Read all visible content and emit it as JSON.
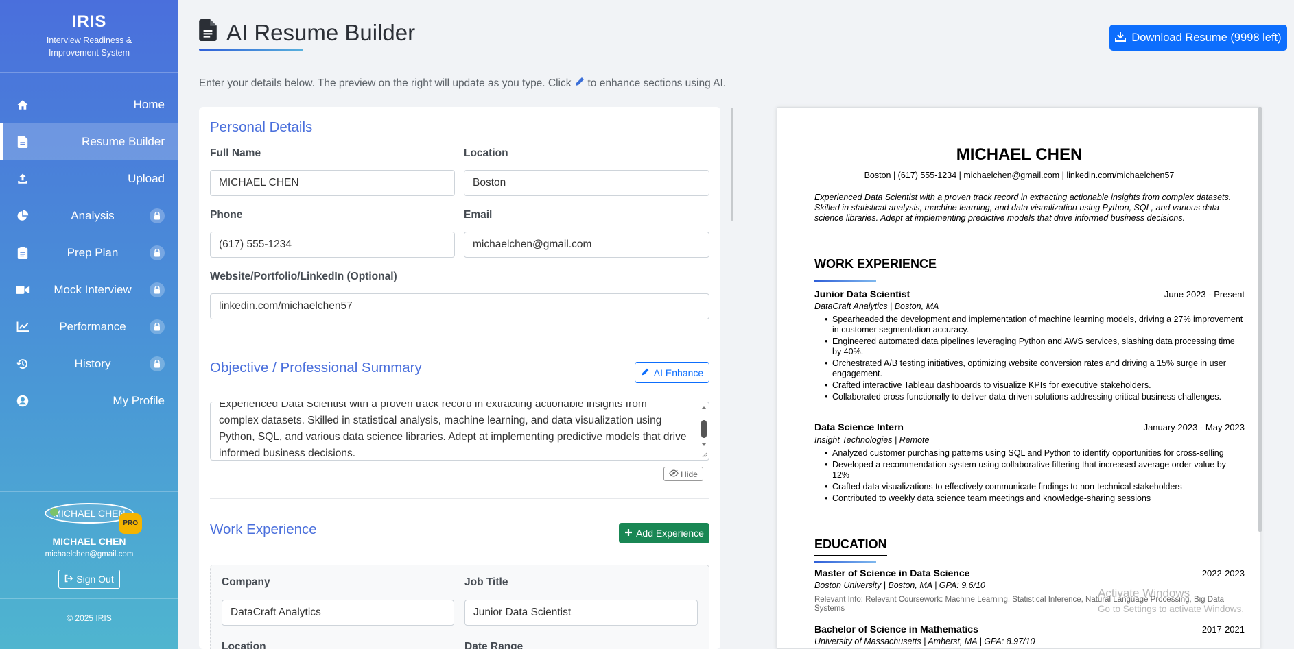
{
  "brand": {
    "title": "IRIS",
    "subtitle": "Interview Readiness & Improvement System"
  },
  "nav": [
    {
      "label": "Home",
      "icon": "home-icon",
      "locked": false,
      "active": false
    },
    {
      "label": "Resume Builder",
      "icon": "file-icon",
      "locked": false,
      "active": true
    },
    {
      "label": "Upload",
      "icon": "upload-icon",
      "locked": false,
      "active": false
    },
    {
      "label": "Analysis",
      "icon": "pie-chart-icon",
      "locked": true,
      "active": false
    },
    {
      "label": "Prep Plan",
      "icon": "clipboard-icon",
      "locked": true,
      "active": false
    },
    {
      "label": "Mock Interview",
      "icon": "video-icon",
      "locked": true,
      "active": false
    },
    {
      "label": "Performance",
      "icon": "line-chart-icon",
      "locked": true,
      "active": false
    },
    {
      "label": "History",
      "icon": "history-icon",
      "locked": true,
      "active": false
    },
    {
      "label": "My Profile",
      "icon": "user-circle-icon",
      "locked": false,
      "active": false
    }
  ],
  "user": {
    "avatar_text": "MICHAEL CHEN",
    "badge": "PRO",
    "name": "MICHAEL CHEN",
    "email": "michaelchen@gmail.com",
    "signout": "Sign Out"
  },
  "copyright": "© 2025 IRIS",
  "header": {
    "title": "AI Resume Builder",
    "download": "Download Resume (9998 left)",
    "intro_before": "Enter your details below. The preview on the right will update as you type. Click",
    "intro_after": "to enhance sections using AI."
  },
  "form": {
    "personal_title": "Personal Details",
    "full_name_label": "Full Name",
    "full_name": "MICHAEL CHEN",
    "location_label": "Location",
    "location": "Boston",
    "phone_label": "Phone",
    "phone": "(617) 555-1234",
    "email_label": "Email",
    "email": "michaelchen@gmail.com",
    "website_label": "Website/Portfolio/LinkedIn (Optional)",
    "website": "linkedin.com/michaelchen57",
    "summary_title": "Objective / Professional Summary",
    "ai_enhance": "AI Enhance",
    "summary_partial": "Experienced Data Scientist with a proven track record in extracting actionable insights from",
    "summary_visible": "complex datasets. Skilled in statistical analysis, machine learning, and data visualization using Python, SQL, and various data science libraries. Adept at implementing predictive models that drive informed business decisions.",
    "hide": "Hide",
    "work_title": "Work Experience",
    "add_experience": "Add Experience",
    "company_label": "Company",
    "company": "DataCraft Analytics",
    "job_title_label": "Job Title",
    "job_title": "Junior Data Scientist",
    "exp_location_label": "Location",
    "date_range_label": "Date Range"
  },
  "resume": {
    "name": "MICHAEL CHEN",
    "contact": "Boston | (617) 555-1234 | michaelchen@gmail.com | linkedin.com/michaelchen57",
    "summary": "Experienced Data Scientist with a proven track record in extracting actionable insights from complex datasets. Skilled in statistical analysis, machine learning, and data visualization using Python, SQL, and various data science libraries. Adept at implementing predictive models that drive informed business decisions.",
    "work_heading": "WORK EXPERIENCE",
    "jobs": [
      {
        "title": "Junior Data Scientist",
        "date": "June 2023 - Present",
        "company": "DataCraft Analytics | Boston, MA",
        "bullets": [
          "Spearheaded the development and implementation of machine learning models, driving a 27% improvement in customer segmentation accuracy.",
          "Engineered automated data pipelines leveraging Python and AWS services, slashing data processing time by 40%.",
          "Orchestrated A/B testing initiatives, optimizing website conversion rates and driving a 15% surge in user engagement.",
          "Crafted interactive Tableau dashboards to visualize KPIs for executive stakeholders.",
          "Collaborated cross-functionally to deliver data-driven solutions addressing critical business challenges."
        ]
      },
      {
        "title": "Data Science Intern",
        "date": "January 2023 - May 2023",
        "company": "Insight Technologies | Remote",
        "bullets": [
          "Analyzed customer purchasing patterns using SQL and Python to identify opportunities for cross-selling",
          "Developed a recommendation system using collaborative filtering that increased average order value by 12%",
          "Crafted data visualizations to effectively communicate findings to non-technical stakeholders",
          "Contributed to weekly data science team meetings and knowledge-sharing sessions"
        ]
      }
    ],
    "education_heading": "EDUCATION",
    "education": [
      {
        "degree": "Master of Science in Data Science",
        "years": "2022-2023",
        "school": "Boston University | Boston, MA | GPA: 9.6/10",
        "info": "Relevant Info: Relevant Coursework: Machine Learning, Statistical Inference, Natural Language Processing, Big Data Systems"
      },
      {
        "degree": "Bachelor of Science in Mathematics",
        "years": "2017-2021",
        "school": "University of Massachusetts | Amherst, MA | GPA: 8.97/10"
      }
    ]
  },
  "watermark": {
    "line1": "Activate Windows",
    "line2": "Go to Settings to activate Windows."
  },
  "colors": {
    "accent": "#4a6fdc",
    "primary_button": "#0d6efd",
    "success_button": "#198754",
    "badge": "#f5b400"
  }
}
